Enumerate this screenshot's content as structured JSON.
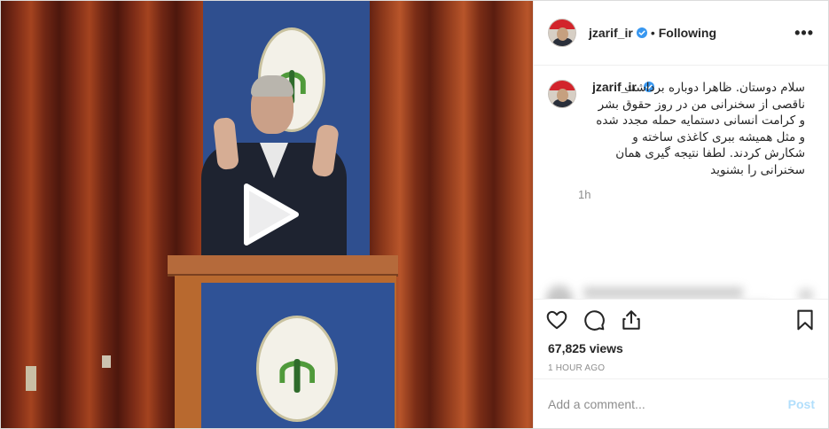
{
  "post": {
    "username": "jzarif_ir",
    "separator": "•",
    "follow_status": "Following",
    "more_icon": "more-horizontal-icon",
    "more_label": "•••"
  },
  "caption": {
    "username": "jzarif_ir",
    "text": "سلام دوستان. ظاهرا دوباره برداشت ناقصی از سخنرانی من در روز حقوق بشر و کرامت انسانی دستمایه حمله مجدد شده و مثل همیشه ببری کاغذی ساخته و شکارش کردند. لطفا نتیجه گیری همان سخنرانی را بشنوید",
    "relative_time": "1h"
  },
  "actions": {
    "like_icon": "heart-icon",
    "comment_icon": "comment-icon",
    "share_icon": "share-icon",
    "save_icon": "bookmark-icon"
  },
  "stats": {
    "views": "67,825 views",
    "timestamp": "1 HOUR AGO"
  },
  "comment_box": {
    "placeholder": "Add a comment...",
    "post_label": "Post"
  },
  "media": {
    "type": "video",
    "play_icon": "play-icon"
  },
  "colors": {
    "verified": "#3897f0",
    "post_disabled": "#b2dffc",
    "muted": "#8e8e8e"
  }
}
